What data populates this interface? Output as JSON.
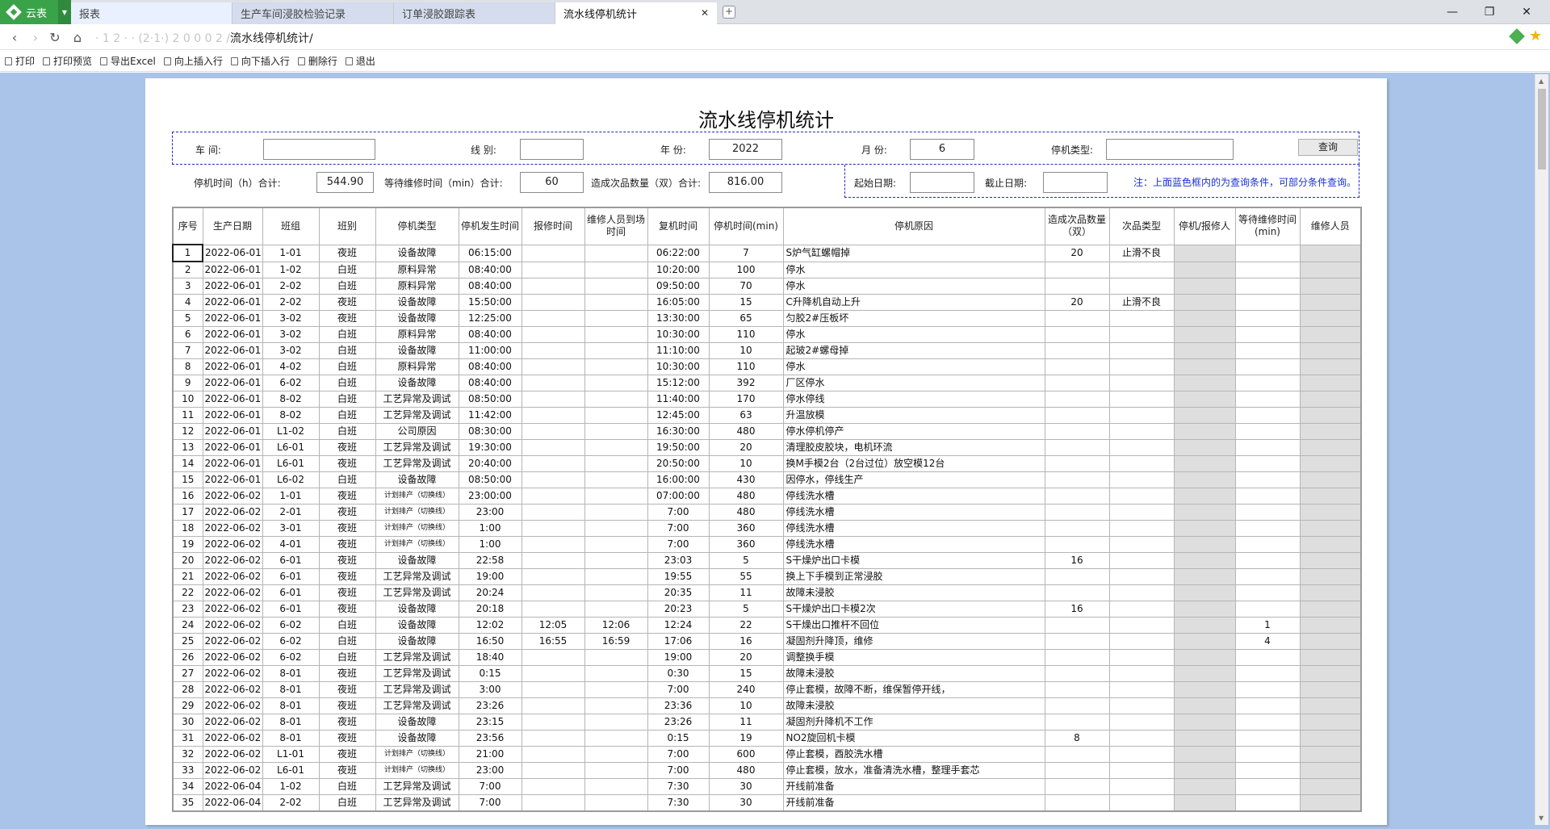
{
  "browser": {
    "app_button": "云表",
    "tabs": [
      {
        "label": "报表",
        "active": false
      },
      {
        "label": "生产车间浸胶检验记录",
        "active": false
      },
      {
        "label": "订单浸胶跟踪表",
        "active": false
      },
      {
        "label": "流水线停机统计",
        "active": true
      }
    ],
    "url_blurred": "· 1 2 · · (2·1·) 2 0 0 0 2 /",
    "url_visible": "流水线停机统计/"
  },
  "toolbar": {
    "items": [
      "打印",
      "打印预览",
      "导出Excel",
      "向上插入行",
      "向下插入行",
      "删除行",
      "退出"
    ]
  },
  "report": {
    "title": "流水线停机统计",
    "labels": {
      "workshop": "车      间:",
      "line": "线  别:",
      "year": "年 份:",
      "month": "月 份:",
      "stop_type": "停机类型:",
      "downtime_total": "停机时间（h）合计:",
      "wait_total": "等待维修时间（min）合计:",
      "defect_total": "造成次品数量（双）合计:",
      "start_date": "起始日期:",
      "end_date": "截止日期:"
    },
    "values": {
      "workshop": "",
      "line": "",
      "year": "2022",
      "month": "6",
      "stop_type": "",
      "downtime_total": "544.90",
      "wait_total": "60",
      "defect_total": "816.00",
      "start_date": "",
      "end_date": ""
    },
    "query_button": "查询",
    "note": "注：上面蓝色框内的为查询条件，可部分条件查询。"
  },
  "table": {
    "headers": [
      "序号",
      "生产日期",
      "班组",
      "班别",
      "停机类型",
      "停机发生时间",
      "报修时间",
      "维修人员到场时间",
      "复机时间",
      "停机时间(min)",
      "停机原因",
      "造成次品数量（双）",
      "次品类型",
      "停机/报修人",
      "等待维修时间(min)",
      "维修人员"
    ],
    "rows": [
      [
        "1",
        "2022-06-01",
        "1-01",
        "夜班",
        "设备故障",
        "06:15:00",
        "",
        "",
        "06:22:00",
        "7",
        "S炉气缸螺帽掉",
        "20",
        "止滑不良",
        "",
        "",
        ""
      ],
      [
        "2",
        "2022-06-01",
        "1-02",
        "白班",
        "原料异常",
        "08:40:00",
        "",
        "",
        "10:20:00",
        "100",
        "停水",
        "",
        "",
        "",
        "",
        ""
      ],
      [
        "3",
        "2022-06-01",
        "2-02",
        "白班",
        "原料异常",
        "08:40:00",
        "",
        "",
        "09:50:00",
        "70",
        "停水",
        "",
        "",
        "",
        "",
        ""
      ],
      [
        "4",
        "2022-06-01",
        "2-02",
        "夜班",
        "设备故障",
        "15:50:00",
        "",
        "",
        "16:05:00",
        "15",
        "C升降机自动上升",
        "20",
        "止滑不良",
        "",
        "",
        ""
      ],
      [
        "5",
        "2022-06-01",
        "3-02",
        "夜班",
        "设备故障",
        "12:25:00",
        "",
        "",
        "13:30:00",
        "65",
        "匀胶2#压板坏",
        "",
        "",
        "",
        "",
        ""
      ],
      [
        "6",
        "2022-06-01",
        "3-02",
        "白班",
        "原料异常",
        "08:40:00",
        "",
        "",
        "10:30:00",
        "110",
        "停水",
        "",
        "",
        "",
        "",
        ""
      ],
      [
        "7",
        "2022-06-01",
        "3-02",
        "白班",
        "设备故障",
        "11:00:00",
        "",
        "",
        "11:10:00",
        "10",
        "起玻2#螺母掉",
        "",
        "",
        "",
        "",
        ""
      ],
      [
        "8",
        "2022-06-01",
        "4-02",
        "白班",
        "原料异常",
        "08:40:00",
        "",
        "",
        "10:30:00",
        "110",
        "停水",
        "",
        "",
        "",
        "",
        ""
      ],
      [
        "9",
        "2022-06-01",
        "6-02",
        "白班",
        "设备故障",
        "08:40:00",
        "",
        "",
        "15:12:00",
        "392",
        "厂区停水",
        "",
        "",
        "",
        "",
        ""
      ],
      [
        "10",
        "2022-06-01",
        "8-02",
        "白班",
        "工艺异常及调试",
        "08:50:00",
        "",
        "",
        "11:40:00",
        "170",
        "停水停线",
        "",
        "",
        "",
        "",
        ""
      ],
      [
        "11",
        "2022-06-01",
        "8-02",
        "白班",
        "工艺异常及调试",
        "11:42:00",
        "",
        "",
        "12:45:00",
        "63",
        "升温放模",
        "",
        "",
        "",
        "",
        ""
      ],
      [
        "12",
        "2022-06-01",
        "L1-02",
        "白班",
        "公司原因",
        "08:30:00",
        "",
        "",
        "16:30:00",
        "480",
        "停水停机停产",
        "",
        "",
        "",
        "",
        ""
      ],
      [
        "13",
        "2022-06-01",
        "L6-01",
        "夜班",
        "工艺异常及调试",
        "19:30:00",
        "",
        "",
        "19:50:00",
        "20",
        "清理胶皮胶块，电机环流",
        "",
        "",
        "",
        "",
        ""
      ],
      [
        "14",
        "2022-06-01",
        "L6-01",
        "夜班",
        "工艺异常及调试",
        "20:40:00",
        "",
        "",
        "20:50:00",
        "10",
        "换M手模2台（2台过位）放空模12台",
        "",
        "",
        "",
        "",
        ""
      ],
      [
        "15",
        "2022-06-01",
        "L6-02",
        "白班",
        "设备故障",
        "08:50:00",
        "",
        "",
        "16:00:00",
        "430",
        "因停水，停线生产",
        "",
        "",
        "",
        "",
        ""
      ],
      [
        "16",
        "2022-06-02",
        "1-01",
        "夜班",
        "计划排产（切换线）",
        "23:00:00",
        "",
        "",
        "07:00:00",
        "480",
        "停线洗水槽",
        "",
        "",
        "",
        "",
        ""
      ],
      [
        "17",
        "2022-06-02",
        "2-01",
        "夜班",
        "计划排产（切换线）",
        "23:00",
        "",
        "",
        "7:00",
        "480",
        "停线洗水槽",
        "",
        "",
        "",
        "",
        ""
      ],
      [
        "18",
        "2022-06-02",
        "3-01",
        "夜班",
        "计划排产（切换线）",
        "1:00",
        "",
        "",
        "7:00",
        "360",
        "停线洗水槽",
        "",
        "",
        "",
        "",
        ""
      ],
      [
        "19",
        "2022-06-02",
        "4-01",
        "夜班",
        "计划排产（切换线）",
        "1:00",
        "",
        "",
        "7:00",
        "360",
        "停线洗水槽",
        "",
        "",
        "",
        "",
        ""
      ],
      [
        "20",
        "2022-06-02",
        "6-01",
        "夜班",
        "设备故障",
        "22:58",
        "",
        "",
        "23:03",
        "5",
        "S干燥炉出口卡模",
        "16",
        "",
        "",
        "",
        ""
      ],
      [
        "21",
        "2022-06-02",
        "6-01",
        "夜班",
        "工艺异常及调试",
        "19:00",
        "",
        "",
        "19:55",
        "55",
        "换上下手模到正常浸胶",
        "",
        "",
        "",
        "",
        ""
      ],
      [
        "22",
        "2022-06-02",
        "6-01",
        "夜班",
        "工艺异常及调试",
        "20:24",
        "",
        "",
        "20:35",
        "11",
        "故障未浸胶",
        "",
        "",
        "",
        "",
        ""
      ],
      [
        "23",
        "2022-06-02",
        "6-01",
        "夜班",
        "设备故障",
        "20:18",
        "",
        "",
        "20:23",
        "5",
        "S干燥炉出口卡模2次",
        "16",
        "",
        "",
        "",
        ""
      ],
      [
        "24",
        "2022-06-02",
        "6-02",
        "白班",
        "设备故障",
        "12:02",
        "12:05",
        "12:06",
        "12:24",
        "22",
        "S干燥出口推杆不回位",
        "",
        "",
        "",
        "1",
        ""
      ],
      [
        "25",
        "2022-06-02",
        "6-02",
        "白班",
        "设备故障",
        "16:50",
        "16:55",
        "16:59",
        "17:06",
        "16",
        "凝固剂升降顶，维修",
        "",
        "",
        "",
        "4",
        ""
      ],
      [
        "26",
        "2022-06-02",
        "6-02",
        "白班",
        "工艺异常及调试",
        "18:40",
        "",
        "",
        "19:00",
        "20",
        "调整换手模",
        "",
        "",
        "",
        "",
        ""
      ],
      [
        "27",
        "2022-06-02",
        "8-01",
        "夜班",
        "工艺异常及调试",
        "0:15",
        "",
        "",
        "0:30",
        "15",
        "故障未浸胶",
        "",
        "",
        "",
        "",
        ""
      ],
      [
        "28",
        "2022-06-02",
        "8-01",
        "夜班",
        "工艺异常及调试",
        "3:00",
        "",
        "",
        "7:00",
        "240",
        "停止套模，故障不断，维保暂停开线，",
        "",
        "",
        "",
        "",
        ""
      ],
      [
        "29",
        "2022-06-02",
        "8-01",
        "夜班",
        "工艺异常及调试",
        "23:26",
        "",
        "",
        "23:36",
        "10",
        "故障未浸胶",
        "",
        "",
        "",
        "",
        ""
      ],
      [
        "30",
        "2022-06-02",
        "8-01",
        "夜班",
        "设备故障",
        "23:15",
        "",
        "",
        "23:26",
        "11",
        "凝固剂升降机不工作",
        "",
        "",
        "",
        "",
        ""
      ],
      [
        "31",
        "2022-06-02",
        "8-01",
        "夜班",
        "设备故障",
        "23:56",
        "",
        "",
        "0:15",
        "19",
        "NO2旋回机卡模",
        "8",
        "",
        "",
        "",
        ""
      ],
      [
        "32",
        "2022-06-02",
        "L1-01",
        "夜班",
        "计划排产（切换线）",
        "21:00",
        "",
        "",
        "7:00",
        "600",
        "停止套模，酉胶洗水槽",
        "",
        "",
        "",
        "",
        ""
      ],
      [
        "33",
        "2022-06-02",
        "L6-01",
        "夜班",
        "计划排产（切换线）",
        "23:00",
        "",
        "",
        "7:00",
        "480",
        "停止套模，放水，准备清洗水槽，整理手套芯",
        "",
        "",
        "",
        "",
        ""
      ],
      [
        "34",
        "2022-06-04",
        "1-02",
        "白班",
        "工艺异常及调试",
        "7:00",
        "",
        "",
        "7:30",
        "30",
        "开线前准备",
        "",
        "",
        "",
        "",
        ""
      ],
      [
        "35",
        "2022-06-04",
        "2-02",
        "白班",
        "工艺异常及调试",
        "7:00",
        "",
        "",
        "7:30",
        "30",
        "开线前准备",
        "",
        "",
        "",
        "",
        ""
      ]
    ]
  }
}
